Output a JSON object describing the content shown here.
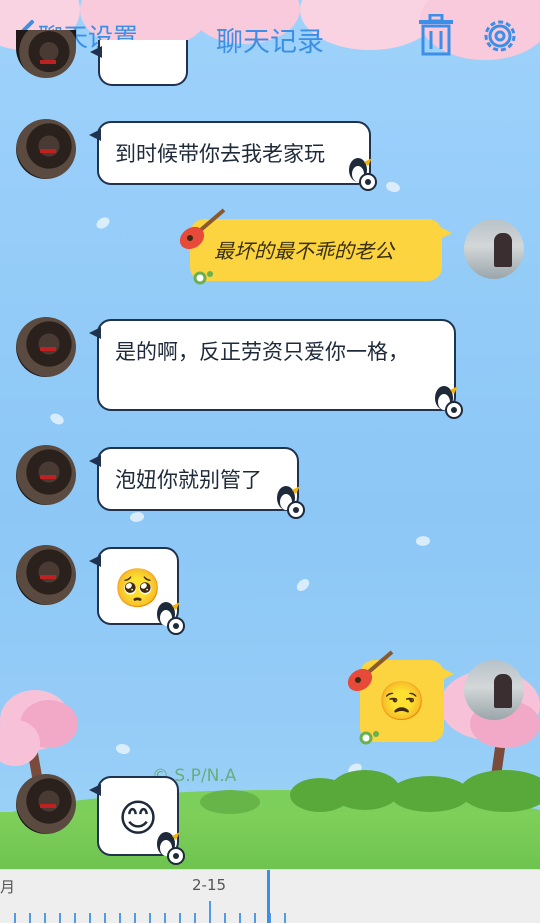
{
  "header": {
    "back_label": "聊天设置",
    "title": "聊天记录",
    "trash_icon": "trash-icon",
    "settings_icon": "gear-icon"
  },
  "messages": [
    {
      "side": "left",
      "text": "到时候带你去我老家玩"
    },
    {
      "side": "right",
      "text": "最坏的最不乖的老公"
    },
    {
      "side": "left",
      "text": "是的啊，反正劳资只爱你一格，"
    },
    {
      "side": "left",
      "text": "泡妞你就别管了"
    },
    {
      "side": "left",
      "emoji": "🥺"
    },
    {
      "side": "right",
      "emoji": "😒"
    },
    {
      "side": "left",
      "emoji": "😊"
    }
  ],
  "watermark": "© S.P/N.A",
  "timeline": {
    "left_label": "月",
    "center_label": "2-15"
  },
  "colors": {
    "accent": "#3c8fe6",
    "bubble_right": "#fcd440",
    "bubble_left_border": "#20324e"
  }
}
